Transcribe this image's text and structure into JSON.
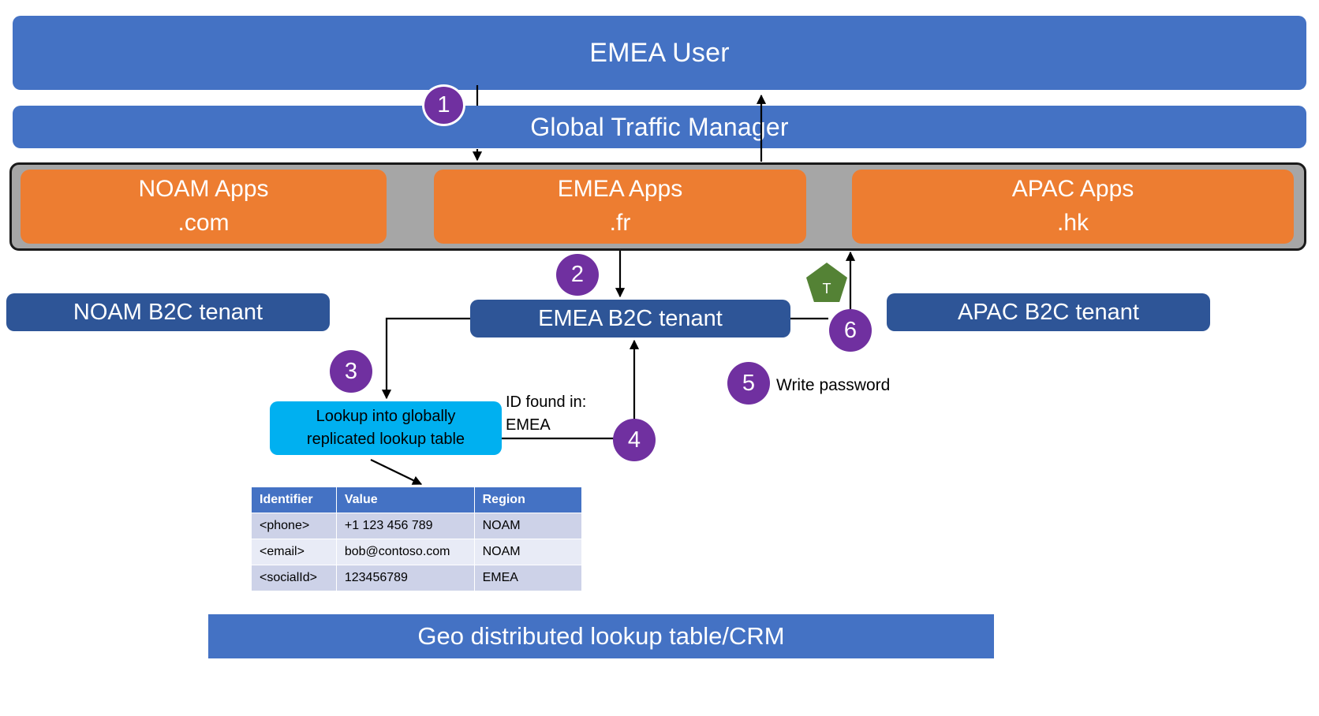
{
  "title": "B2C geo-distributed identity routing diagram",
  "colors": {
    "blue_bar": "#4472C4",
    "orange_app": "#ED7D31",
    "navy_tenant": "#2E5597",
    "grey_container": "#A6A6A6",
    "cyan_lookup": "#00B0F0",
    "purple_step": "#7030A0",
    "green_token": "#548235",
    "table_header": "#4472C4",
    "table_row_odd": "#CDD2E8",
    "table_row_even": "#E8EBF6"
  },
  "user_bar": {
    "label": "EMEA User"
  },
  "traffic_manager": {
    "label": "Global Traffic Manager"
  },
  "apps": [
    {
      "name": "NOAM Apps",
      "domain": ".com"
    },
    {
      "name": "EMEA Apps",
      "domain": ".fr"
    },
    {
      "name": "APAC Apps",
      "domain": ".hk"
    }
  ],
  "tenants": [
    {
      "label": "NOAM B2C tenant"
    },
    {
      "label": "EMEA B2C tenant"
    },
    {
      "label": "APAC B2C tenant"
    }
  ],
  "lookup_box": {
    "line1": "Lookup into globally",
    "line2": "replicated lookup table"
  },
  "annotations": {
    "id_found": "ID found in:\nEMEA",
    "write_password": "Write password",
    "token_badge": "T"
  },
  "steps": [
    {
      "number": "1"
    },
    {
      "number": "2"
    },
    {
      "number": "3"
    },
    {
      "number": "4"
    },
    {
      "number": "5"
    },
    {
      "number": "6"
    }
  ],
  "table": {
    "headers": [
      "Identifier",
      "Value",
      "Region"
    ],
    "rows": [
      [
        "<phone>",
        "+1 123 456 789",
        "NOAM"
      ],
      [
        "<email>",
        "bob@contoso.com",
        "NOAM"
      ],
      [
        "<socialId>",
        "123456789",
        "EMEA"
      ]
    ]
  },
  "footer": {
    "label": "Geo distributed lookup table/CRM"
  }
}
